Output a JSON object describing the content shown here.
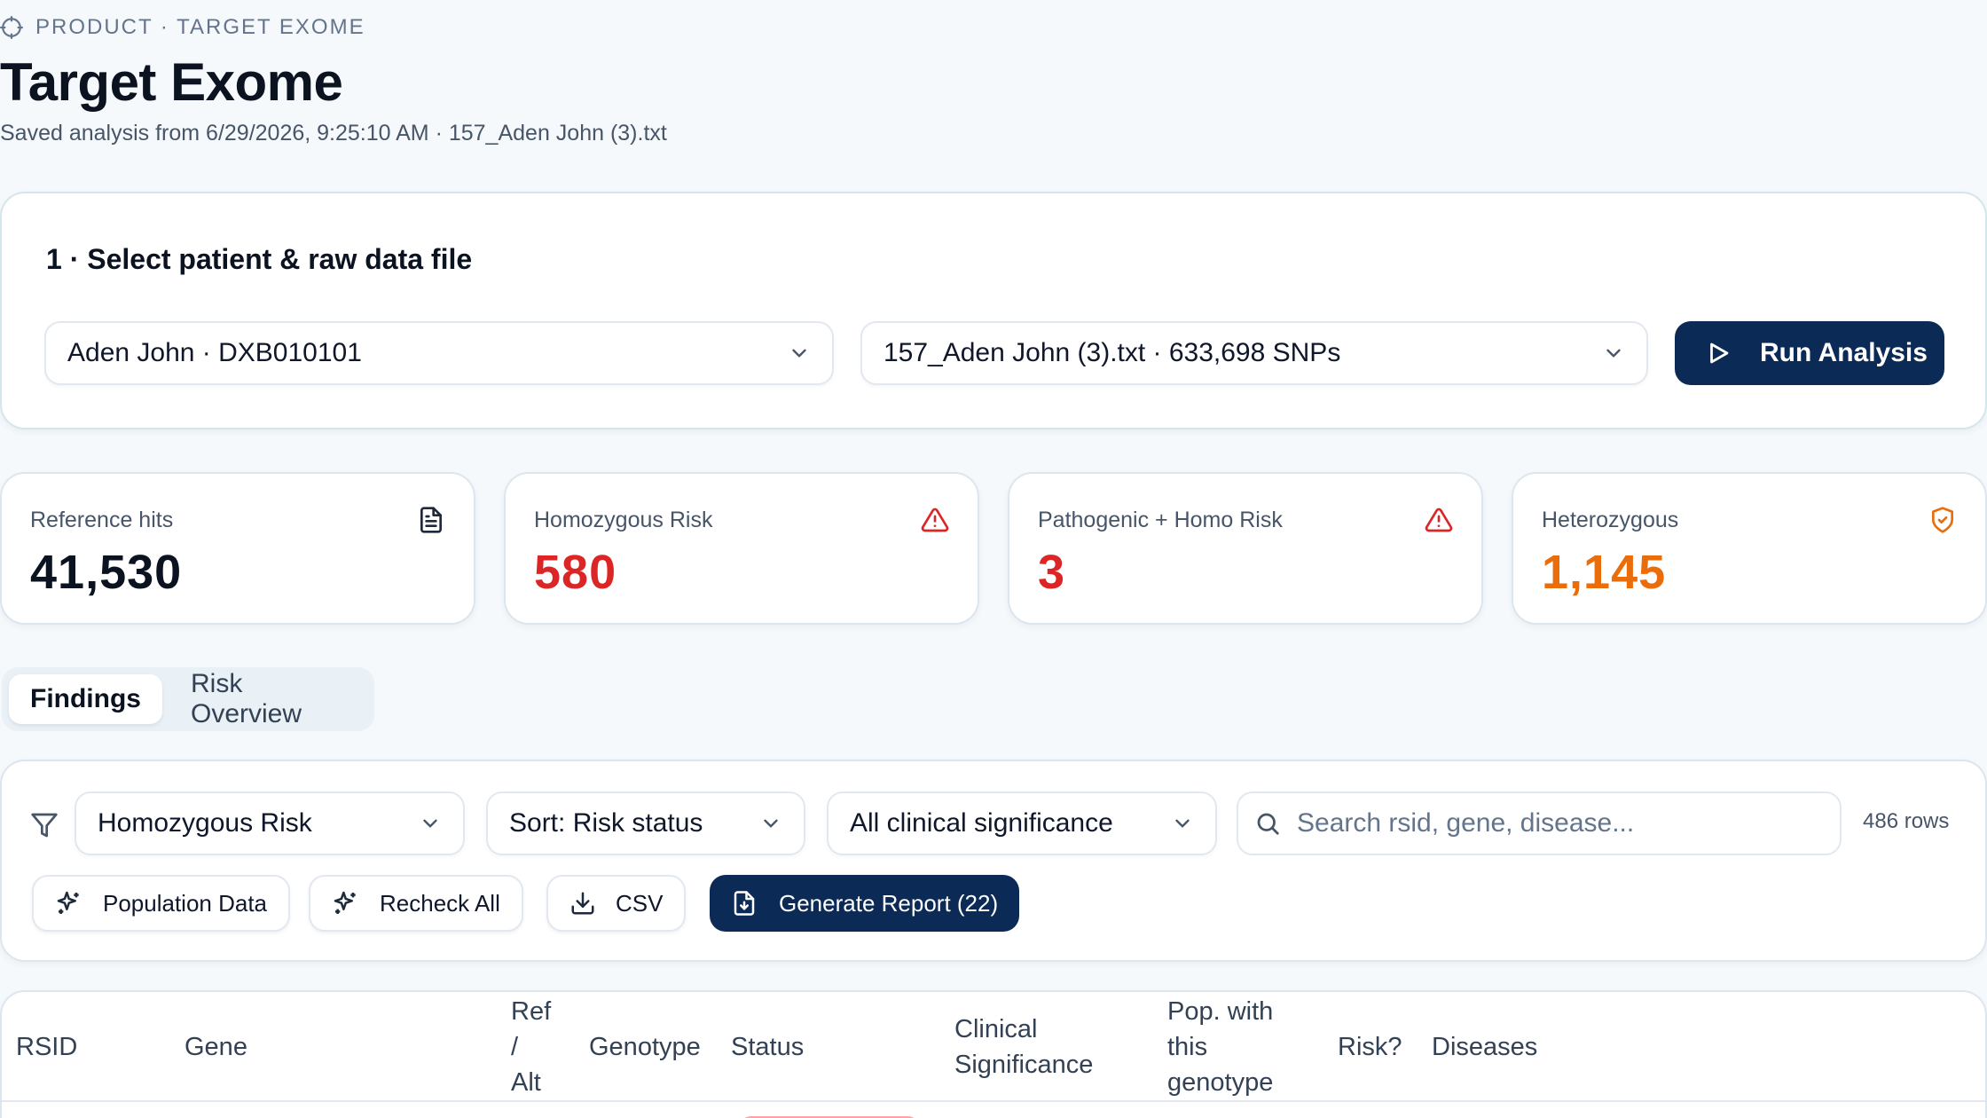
{
  "header": {
    "breadcrumb": "PRODUCT · TARGET EXOME",
    "title": "Target Exome",
    "subtitle": "Saved analysis from 6/29/2026, 9:25:10 AM · 157_Aden John (3).txt"
  },
  "select": {
    "title": "1 · Select patient & raw data file",
    "patient": "Aden John · DXB010101",
    "file": "157_Aden John (3).txt · 633,698 SNPs",
    "run_label": "Run Analysis"
  },
  "stats": [
    {
      "label": "Reference hits",
      "value": "41,530",
      "color": "#0b1220",
      "icon": "document-icon"
    },
    {
      "label": "Homozygous Risk",
      "value": "580",
      "color": "#dc2626",
      "icon": "alert-triangle-icon"
    },
    {
      "label": "Pathogenic + Homo Risk",
      "value": "3",
      "color": "#dc2626",
      "icon": "alert-triangle-icon"
    },
    {
      "label": "Heterozygous",
      "value": "1,145",
      "color": "#ea6d0c",
      "icon": "shield-check-icon"
    }
  ],
  "tabs": {
    "findings": "Findings",
    "risk_overview": "Risk Overview",
    "active": "findings"
  },
  "filters": {
    "status_filter": "Homozygous Risk",
    "sort": "Sort: Risk status",
    "significance": "All clinical significance",
    "search_placeholder": "Search rsid, gene, disease...",
    "rows_count": "486 rows"
  },
  "actions": {
    "population_data": "Population Data",
    "recheck_all": "Recheck All",
    "csv": "CSV",
    "generate_report": "Generate Report (22)"
  },
  "table": {
    "columns": {
      "rsid": "RSID",
      "gene": "Gene",
      "ref_alt_1": "Ref",
      "ref_alt_2": "/",
      "ref_alt_3": "Alt",
      "genotype": "Genotype",
      "status": "Status",
      "clinical_1": "Clinical",
      "clinical_2": "Significance",
      "pop_1": "Pop. with",
      "pop_2": "this",
      "pop_3": "genotype",
      "risk": "Risk?",
      "diseases": "Diseases"
    }
  },
  "colors": {
    "accent_dark": "#0b2a55",
    "risk_red": "#dc2626",
    "hetero_orange": "#ea6d0c"
  }
}
